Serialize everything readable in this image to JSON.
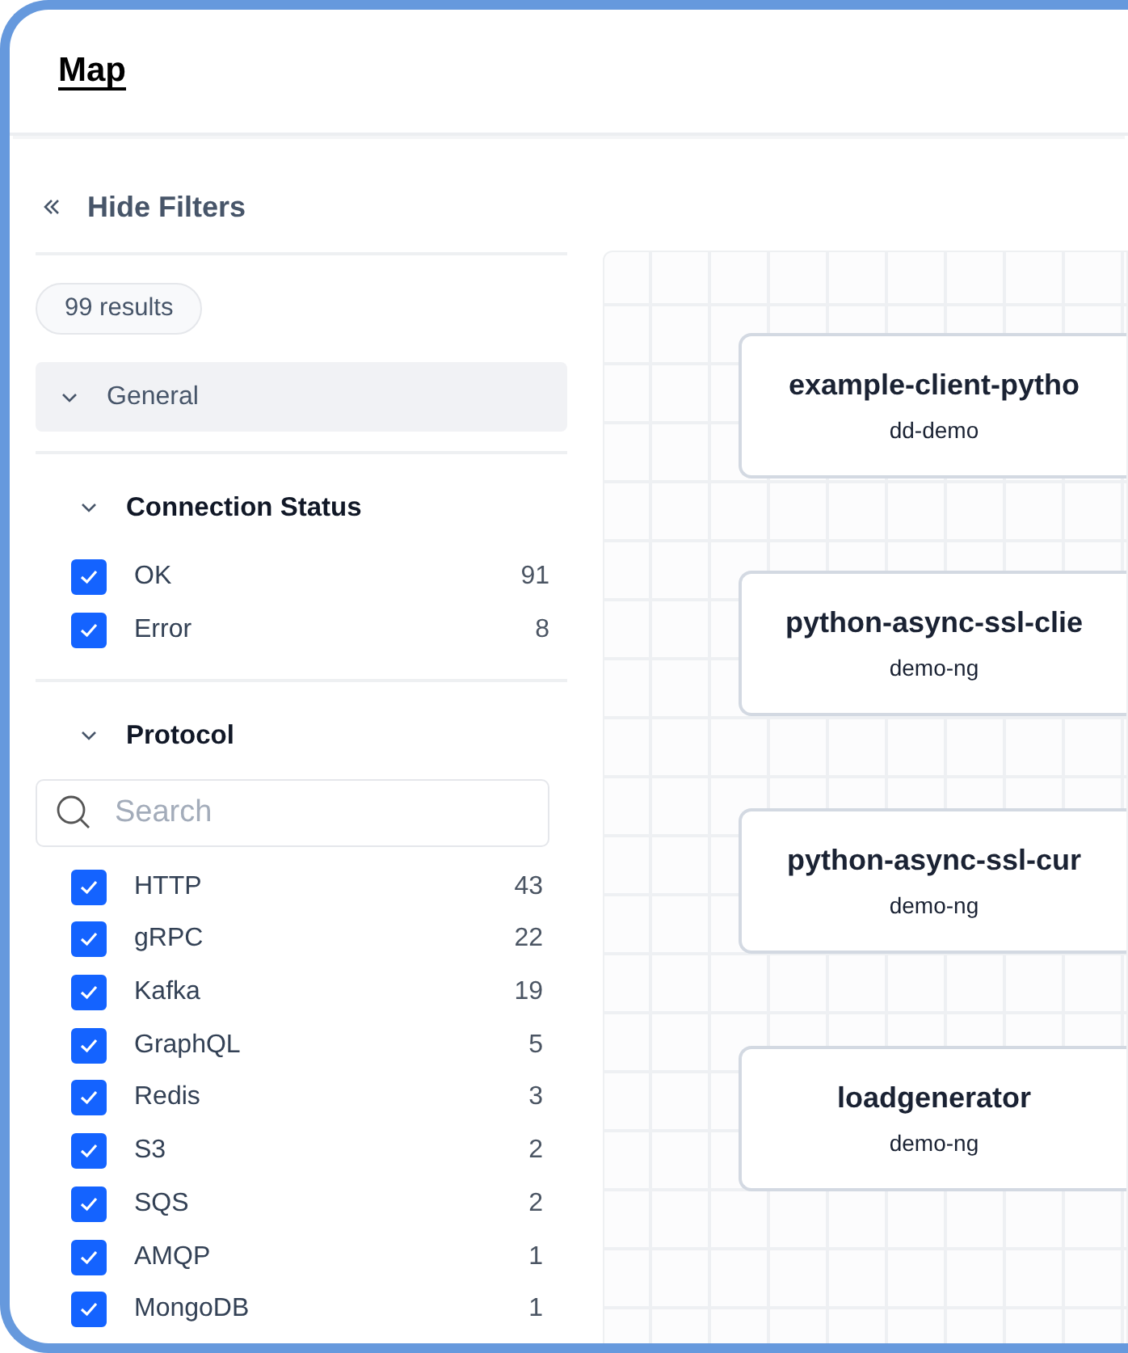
{
  "page": {
    "title": "Map"
  },
  "filters": {
    "toggle_label": "Hide Filters",
    "result_count": "99 results",
    "group": {
      "label": "General"
    },
    "sections": [
      {
        "title": "Connection Status",
        "options": [
          {
            "label": "OK",
            "count": "91",
            "checked": true
          },
          {
            "label": "Error",
            "count": "8",
            "checked": true
          }
        ]
      },
      {
        "title": "Protocol",
        "search": {
          "placeholder": "Search"
        },
        "options": [
          {
            "label": "HTTP",
            "count": "43",
            "checked": true
          },
          {
            "label": "gRPC",
            "count": "22",
            "checked": true
          },
          {
            "label": "Kafka",
            "count": "19",
            "checked": true
          },
          {
            "label": "GraphQL",
            "count": "5",
            "checked": true
          },
          {
            "label": "Redis",
            "count": "3",
            "checked": true
          },
          {
            "label": "S3",
            "count": "2",
            "checked": true
          },
          {
            "label": "SQS",
            "count": "2",
            "checked": true
          },
          {
            "label": "AMQP",
            "count": "1",
            "checked": true
          },
          {
            "label": "MongoDB",
            "count": "1",
            "checked": true
          }
        ]
      }
    ]
  },
  "map": {
    "nodes": [
      {
        "name": "example-client-pytho",
        "namespace": "dd-demo"
      },
      {
        "name": "python-async-ssl-clie",
        "namespace": "demo-ng"
      },
      {
        "name": "python-async-ssl-cur",
        "namespace": "demo-ng"
      },
      {
        "name": "loadgenerator",
        "namespace": "demo-ng"
      }
    ]
  }
}
